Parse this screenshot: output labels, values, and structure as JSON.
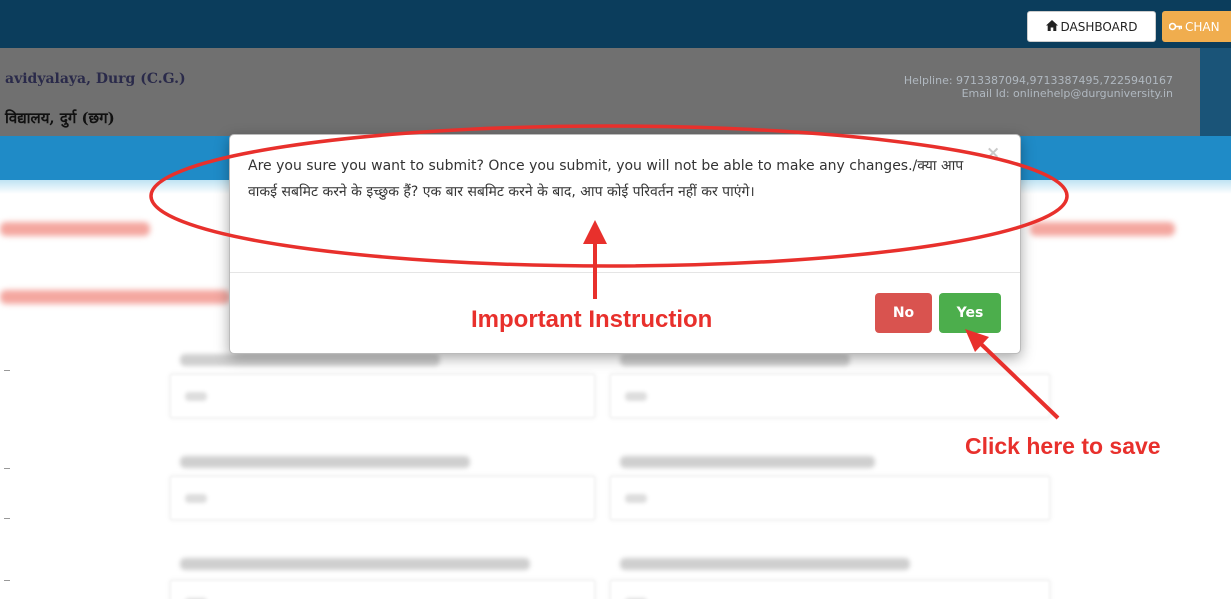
{
  "topbar": {
    "dashboard_label": "DASHBOARD",
    "change_label": "CHAN"
  },
  "header": {
    "university_name_en": "avidyalaya, Durg (C.G.)",
    "university_name_hi": "विद्यालय, दुर्ग (छग)",
    "helpline": "Helpline: 9713387094,9713387495,7225940167",
    "email": "Email Id: onlinehelp@durguniversity.in"
  },
  "modal": {
    "message": "Are you sure you want to submit? Once you submit, you will not be able to make any changes./क्या आप वाकई सबमिट करने के इच्छुक हैं? एक बार सबमिट करने के बाद, आप कोई परिवर्तन नहीं कर पाएंगे।",
    "close_symbol": "×",
    "no_label": "No",
    "yes_label": "Yes"
  },
  "annotations": {
    "important": "Important Instruction",
    "click_to_save": "Click here to save"
  },
  "colors": {
    "topbar": "#0b3d5c",
    "blue_strip": "#1f8bc7",
    "no_button": "#d9534f",
    "yes_button": "#4cae4c",
    "annotation_red": "#e8302c"
  },
  "icons": {
    "dashboard": "home-icon",
    "change": "key-icon",
    "close": "close-icon"
  }
}
